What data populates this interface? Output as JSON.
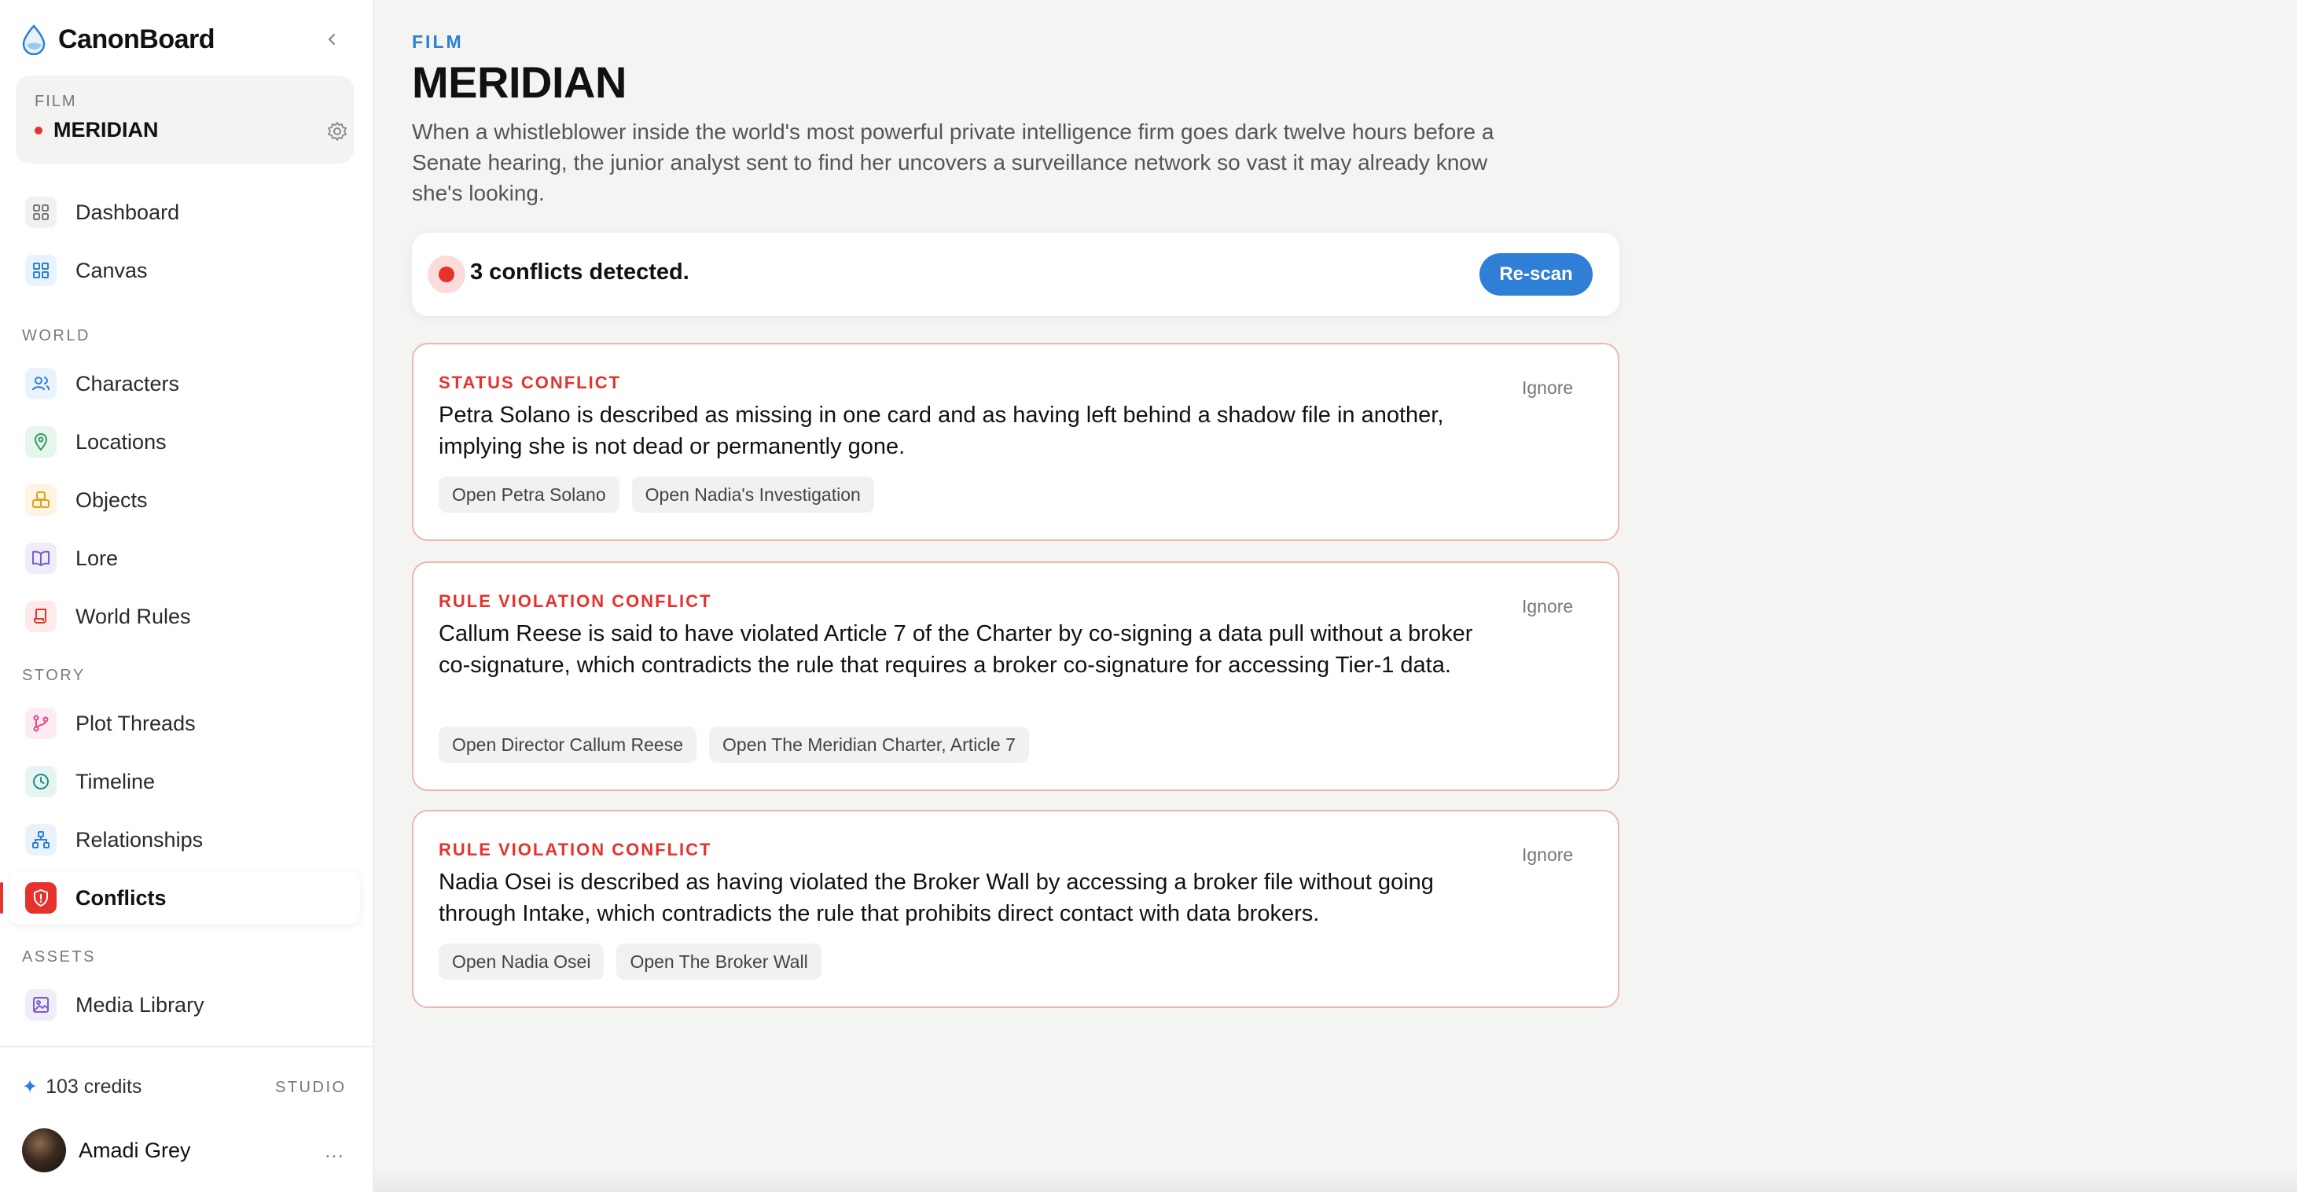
{
  "app": {
    "name": "CanonBoard"
  },
  "project": {
    "type": "FILM",
    "name": "MERIDIAN"
  },
  "nav": {
    "top": [
      {
        "label": "Dashboard",
        "icon": "dashboard-icon"
      },
      {
        "label": "Canvas",
        "icon": "canvas-icon"
      }
    ],
    "sections": [
      {
        "title": "WORLD",
        "items": [
          {
            "label": "Characters",
            "icon": "characters-icon"
          },
          {
            "label": "Locations",
            "icon": "location-pin-icon"
          },
          {
            "label": "Objects",
            "icon": "objects-icon"
          },
          {
            "label": "Lore",
            "icon": "book-icon"
          },
          {
            "label": "World Rules",
            "icon": "scroll-icon"
          }
        ]
      },
      {
        "title": "STORY",
        "items": [
          {
            "label": "Plot Threads",
            "icon": "branch-icon"
          },
          {
            "label": "Timeline",
            "icon": "clock-icon"
          },
          {
            "label": "Relationships",
            "icon": "hierarchy-icon"
          },
          {
            "label": "Conflicts",
            "icon": "shield-alert-icon",
            "active": true
          }
        ]
      },
      {
        "title": "ASSETS",
        "items": [
          {
            "label": "Media Library",
            "icon": "image-icon"
          }
        ]
      }
    ]
  },
  "account": {
    "credits": "103 credits",
    "plan": "STUDIO",
    "user_name": "Amadi Grey",
    "more": "…"
  },
  "header": {
    "kicker": "FILM",
    "title": "MERIDIAN",
    "logline": "When a whistleblower inside the world's most powerful private intelligence firm goes dark twelve hours before a Senate hearing, the junior analyst sent to find her uncovers a surveillance network so vast it may already know she's looking."
  },
  "summary": {
    "text": "3 conflicts detected.",
    "rescan_label": "Re-scan"
  },
  "conflicts": [
    {
      "type": "STATUS CONFLICT",
      "description": "Petra Solano is described as missing in one card and as having left behind a shadow file in another, implying she is not dead or permanently gone.",
      "ignore_label": "Ignore",
      "links": [
        "Open Petra Solano",
        "Open Nadia's Investigation"
      ]
    },
    {
      "type": "RULE VIOLATION CONFLICT",
      "description": "Callum Reese is said to have violated Article 7 of the Charter by co-signing a data pull without a broker co-signature, which contradicts the rule that requires a broker co-signature for accessing Tier-1 data.",
      "ignore_label": "Ignore",
      "links": [
        "Open Director Callum Reese",
        "Open The Meridian Charter, Article 7"
      ]
    },
    {
      "type": "RULE VIOLATION CONFLICT",
      "description": "Nadia Osei is described as having violated the Broker Wall by accessing a broker file without going through Intake, which contradicts the rule that prohibits direct contact with data brokers.",
      "ignore_label": "Ignore",
      "links": [
        "Open Nadia Osei",
        "Open The Broker Wall"
      ]
    }
  ],
  "colors": {
    "accent": "#2f7fd6",
    "danger": "#e5322d",
    "danger_border": "#f2b3b1"
  }
}
